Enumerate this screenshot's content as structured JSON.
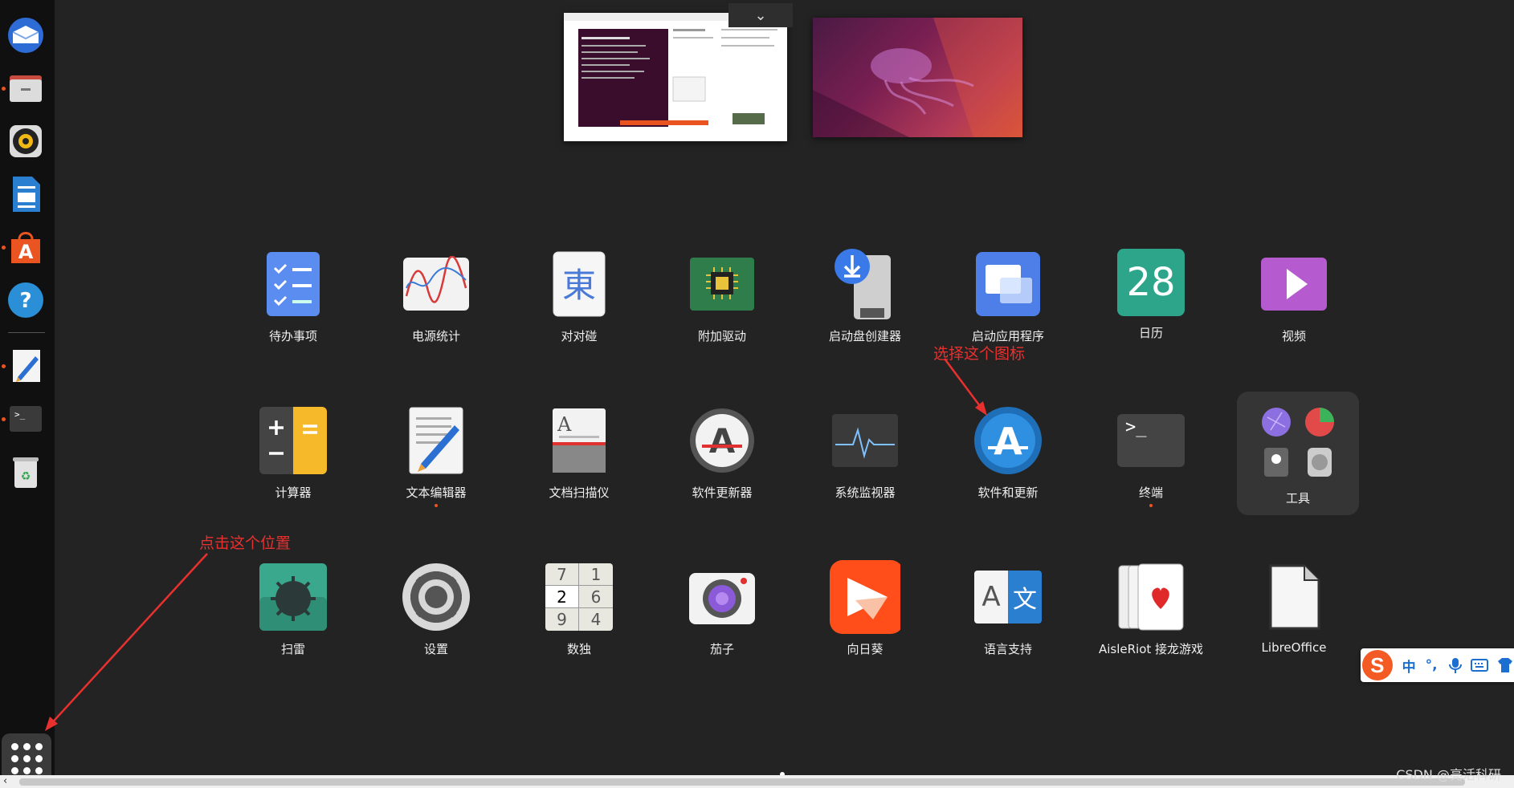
{
  "dock": {
    "items": [
      {
        "name": "thunderbird"
      },
      {
        "name": "files"
      },
      {
        "name": "rhythmbox"
      },
      {
        "name": "libreoffice-writer"
      },
      {
        "name": "ubuntu-software"
      },
      {
        "name": "help"
      },
      {
        "name": "text-editor"
      },
      {
        "name": "terminal"
      },
      {
        "name": "trash"
      }
    ],
    "show_apps_label": ""
  },
  "workspaces": {
    "chevron": "⌄"
  },
  "apps": [
    {
      "id": "todo",
      "label": "待办事项"
    },
    {
      "id": "power",
      "label": "电源统计"
    },
    {
      "id": "mahjongg",
      "label": "对对碰"
    },
    {
      "id": "drivers",
      "label": "附加驱动"
    },
    {
      "id": "usb",
      "label": "启动盘创建器"
    },
    {
      "id": "startup",
      "label": "启动应用程序"
    },
    {
      "id": "calendar",
      "label": "日历",
      "number": "28"
    },
    {
      "id": "videos",
      "label": "视频"
    },
    {
      "id": "calculator",
      "label": "计算器"
    },
    {
      "id": "texteditor",
      "label": "文本编辑器"
    },
    {
      "id": "scanner",
      "label": "文档扫描仪"
    },
    {
      "id": "updater",
      "label": "软件更新器"
    },
    {
      "id": "monitor",
      "label": "系统监视器"
    },
    {
      "id": "software",
      "label": "软件和更新"
    },
    {
      "id": "terminal",
      "label": "终端",
      "glyph": ">_"
    },
    {
      "id": "tools",
      "label": "工具"
    },
    {
      "id": "mines",
      "label": "扫雷"
    },
    {
      "id": "settings",
      "label": "设置"
    },
    {
      "id": "sudoku",
      "label": "数独",
      "cells": [
        "7",
        "1",
        "2",
        "6",
        "9",
        "4"
      ]
    },
    {
      "id": "cheese",
      "label": "茄子"
    },
    {
      "id": "sunlogin",
      "label": "向日葵"
    },
    {
      "id": "language",
      "label": "语言支持",
      "a": "A",
      "zh": "文"
    },
    {
      "id": "aisleriot",
      "label": "AisleRiot 接龙游戏"
    },
    {
      "id": "libreoffice",
      "label": "LibreOffice"
    }
  ],
  "annotations": {
    "select_icon": "选择这个图标",
    "click_here": "点击这个位置"
  },
  "ime": {
    "logo": "S",
    "mode": "中",
    "punct": "°,",
    "items": [
      "mic-icon",
      "keyboard-icon",
      "skin-icon"
    ]
  },
  "watermark": "CSDN @亮活科研",
  "colors": {
    "accent": "#e95420",
    "annotation": "#e8312f"
  }
}
